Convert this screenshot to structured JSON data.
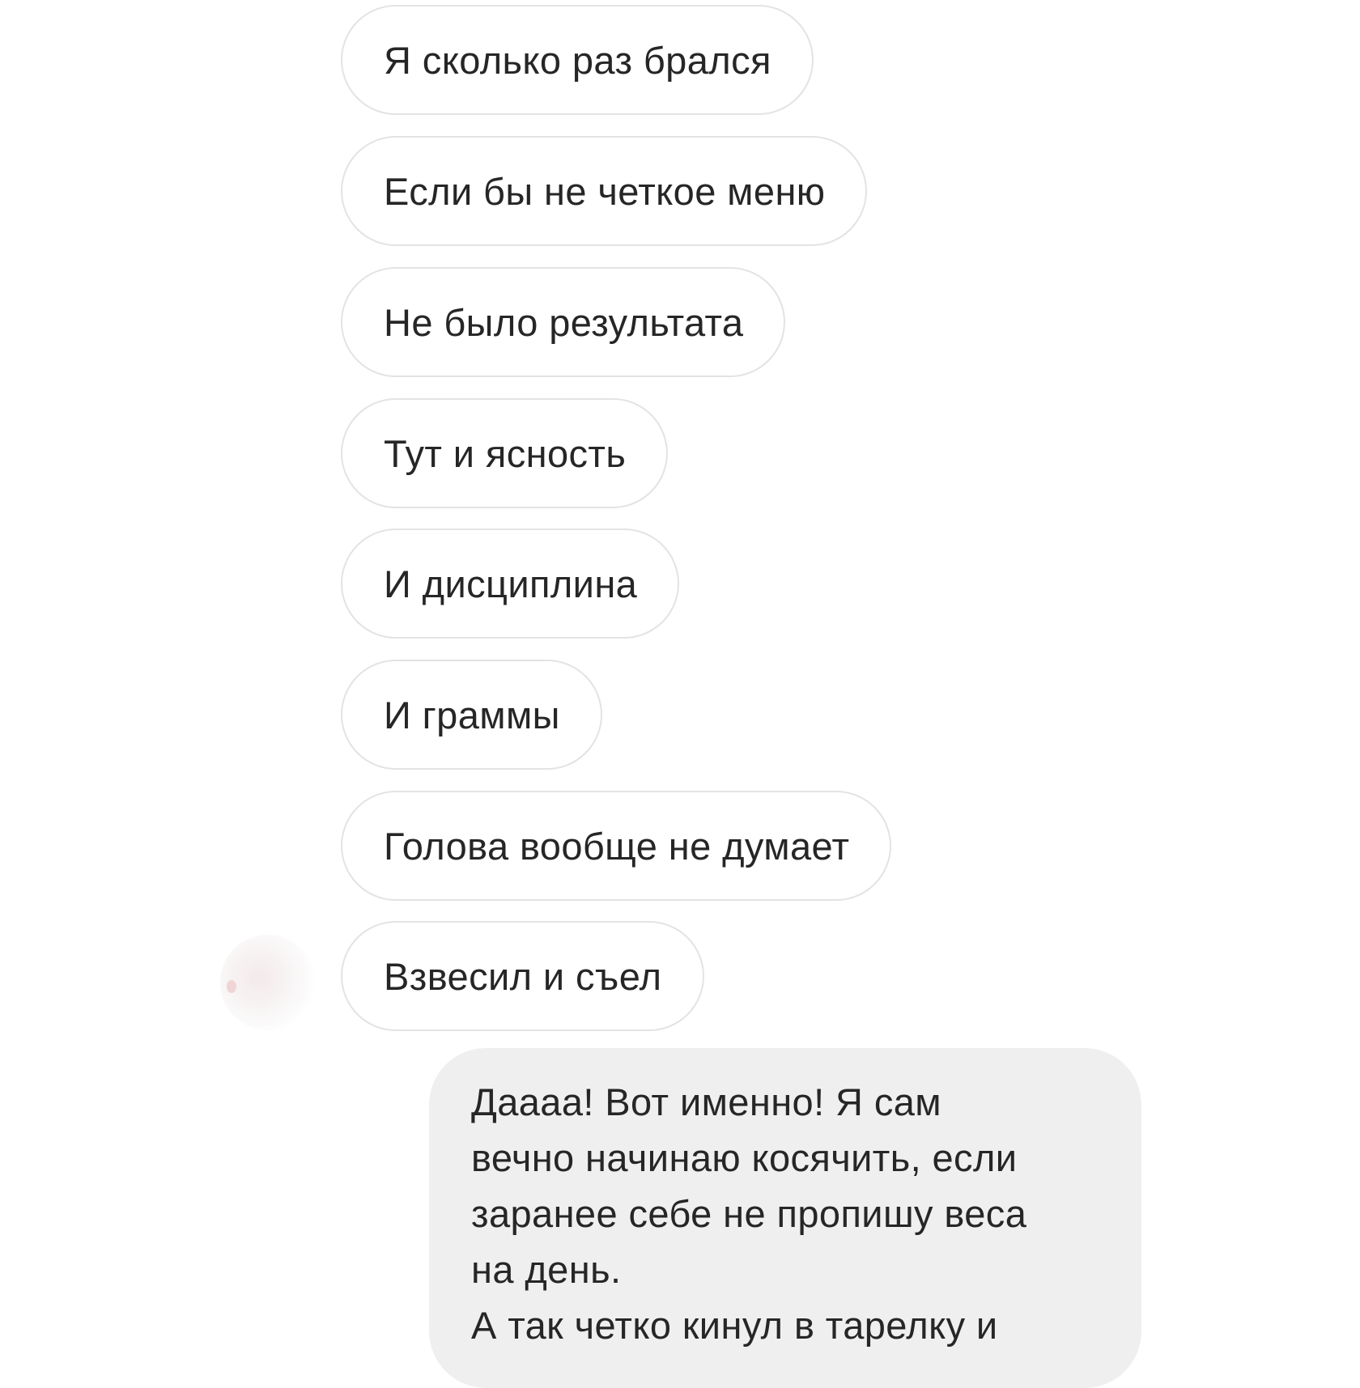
{
  "thread": {
    "incoming": [
      "Я сколько раз брался",
      "Если бы не четкое меню",
      "Не было результата",
      "Тут и ясность",
      "И дисциплина",
      "И граммы",
      "Голова вообще не думает",
      "Взвесил и съел"
    ],
    "outgoing": {
      "lines": [
        "Даааа! Вот именно! Я сам",
        "вечно начинаю косячить, если",
        "заранее себе не пропишу веса",
        "на день.",
        "А так четко кинул в тарелку и"
      ]
    }
  }
}
